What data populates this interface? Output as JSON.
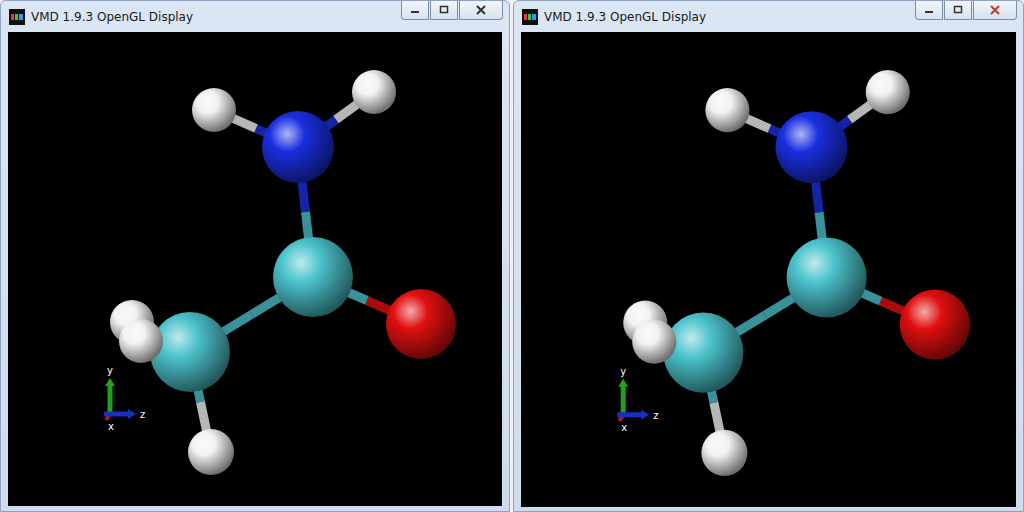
{
  "windows": [
    {
      "title": "VMD 1.9.3 OpenGL Display"
    },
    {
      "title": "VMD 1.9.3 OpenGL Display"
    }
  ],
  "axis_labels": [
    "y",
    "z",
    "x"
  ],
  "molecule": {
    "atoms": [
      {
        "element": "H",
        "color": "#f2f2f2"
      },
      {
        "element": "H",
        "color": "#f2f2f2"
      },
      {
        "element": "N",
        "color": "#1a2fe0"
      },
      {
        "element": "C",
        "color": "#4cc3cc"
      },
      {
        "element": "O",
        "color": "#e01010"
      },
      {
        "element": "C",
        "color": "#4cc3cc"
      },
      {
        "element": "H",
        "color": "#f2f2f2"
      },
      {
        "element": "H",
        "color": "#f2f2f2"
      },
      {
        "element": "H",
        "color": "#f2f2f2"
      }
    ],
    "bonds": [
      [
        2,
        0
      ],
      [
        2,
        1
      ],
      [
        2,
        3
      ],
      [
        3,
        4
      ],
      [
        3,
        5
      ],
      [
        5,
        6
      ],
      [
        5,
        7
      ],
      [
        5,
        8
      ]
    ]
  }
}
